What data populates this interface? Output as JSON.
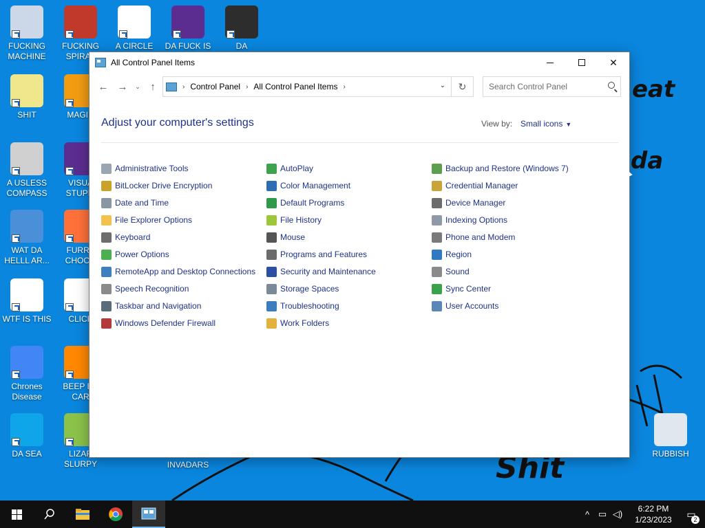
{
  "desktop": {
    "icons": [
      {
        "label": "FUCKING MACHINE",
        "color": "#ccd7e8"
      },
      {
        "label": "FUCKING SPIRAL",
        "color": "#c0392b"
      },
      {
        "label": "A CIRCLE",
        "color": "#ffffff"
      },
      {
        "label": "DA FUCK IS",
        "color": "#5c2d91"
      },
      {
        "label": "DA UNIVERSE",
        "color": "#2d2d2d"
      },
      {
        "label": "SHIT",
        "color": "#f0e68c"
      },
      {
        "label": "MAGIN",
        "color": "#f39c12"
      },
      {
        "label": "A USLESS COMPASS",
        "color": "#d0d0d0"
      },
      {
        "label": "VISUA STUPIT",
        "color": "#5c2d91"
      },
      {
        "label": "WAT DA HELLL AR...",
        "color": "#4a90d9"
      },
      {
        "label": "FURRY CHOCO",
        "color": "#ff7139"
      },
      {
        "label": "WTF IS THIS",
        "color": "#ffffff"
      },
      {
        "label": "CLICK",
        "color": "#ffffff"
      },
      {
        "label": "Chrones Disease",
        "color": "#4285f4"
      },
      {
        "label": "BEEP BE CAR",
        "color": "#ff8800"
      },
      {
        "label": "DA SEA",
        "color": "#0ea5e9"
      },
      {
        "label": "LIZAR SLURPY",
        "color": "#8bc34a"
      },
      {
        "label": "INVADARS",
        "color": "#0a86de"
      },
      {
        "label": "RUBBISH",
        "color": "#dfe7ef"
      }
    ],
    "wallpaper_words": [
      "eat",
      "da",
      "Shit"
    ]
  },
  "window": {
    "title": "All Control Panel Items",
    "nav": {
      "breadcrumbs": [
        "Control Panel",
        "All Control Panel Items"
      ],
      "search_placeholder": "Search Control Panel"
    },
    "heading": "Adjust your computer's settings",
    "view_by_label": "View by:",
    "view_by_value": "Small icons",
    "columns": [
      [
        {
          "label": "Administrative Tools",
          "icon": "admin-tools-icon",
          "color": "#9aa5b1"
        },
        {
          "label": "BitLocker Drive Encryption",
          "icon": "bitlocker-icon",
          "color": "#c9a227"
        },
        {
          "label": "Date and Time",
          "icon": "clock-icon",
          "color": "#8a96a3"
        },
        {
          "label": "File Explorer Options",
          "icon": "folder-options-icon",
          "color": "#f2c14e"
        },
        {
          "label": "Keyboard",
          "icon": "keyboard-icon",
          "color": "#6d6d6d"
        },
        {
          "label": "Power Options",
          "icon": "power-icon",
          "color": "#4caf50"
        },
        {
          "label": "RemoteApp and Desktop Connections",
          "icon": "remoteapp-icon",
          "color": "#3f7fbf"
        },
        {
          "label": "Speech Recognition",
          "icon": "microphone-icon",
          "color": "#8a8a8a"
        },
        {
          "label": "Taskbar and Navigation",
          "icon": "taskbar-icon",
          "color": "#5a6b7a"
        },
        {
          "label": "Windows Defender Firewall",
          "icon": "firewall-icon",
          "color": "#b33a3a"
        }
      ],
      [
        {
          "label": "AutoPlay",
          "icon": "autoplay-icon",
          "color": "#3fa34d"
        },
        {
          "label": "Color Management",
          "icon": "color-management-icon",
          "color": "#2e6db4"
        },
        {
          "label": "Default Programs",
          "icon": "default-programs-icon",
          "color": "#2e9a4a"
        },
        {
          "label": "File History",
          "icon": "file-history-icon",
          "color": "#9cc73b"
        },
        {
          "label": "Mouse",
          "icon": "mouse-icon",
          "color": "#555555"
        },
        {
          "label": "Programs and Features",
          "icon": "programs-icon",
          "color": "#6b6b6b"
        },
        {
          "label": "Security and Maintenance",
          "icon": "flag-icon",
          "color": "#2b4fa3"
        },
        {
          "label": "Storage Spaces",
          "icon": "storage-icon",
          "color": "#7b8a99"
        },
        {
          "label": "Troubleshooting",
          "icon": "troubleshooting-icon",
          "color": "#3c7dbf"
        },
        {
          "label": "Work Folders",
          "icon": "work-folders-icon",
          "color": "#e3b23c"
        }
      ],
      [
        {
          "label": "Backup and Restore (Windows 7)",
          "icon": "backup-icon",
          "color": "#5aa04f"
        },
        {
          "label": "Credential Manager",
          "icon": "credential-icon",
          "color": "#c8a43a"
        },
        {
          "label": "Device Manager",
          "icon": "device-manager-icon",
          "color": "#6c6c6c"
        },
        {
          "label": "Indexing Options",
          "icon": "indexing-icon",
          "color": "#8e9aa6"
        },
        {
          "label": "Phone and Modem",
          "icon": "phone-icon",
          "color": "#7a7a7a"
        },
        {
          "label": "Region",
          "icon": "globe-icon",
          "color": "#2f78c4"
        },
        {
          "label": "Sound",
          "icon": "speaker-icon",
          "color": "#8a8a8a"
        },
        {
          "label": "Sync Center",
          "icon": "sync-icon",
          "color": "#3aa24a"
        },
        {
          "label": "User Accounts",
          "icon": "user-accounts-icon",
          "color": "#5b87b8"
        }
      ]
    ]
  },
  "taskbar": {
    "time": "6:22 PM",
    "date": "1/23/2023",
    "notifications": "2"
  },
  "colors": {
    "desktop_bg": "#0a86de",
    "link_blue": "#1e3287",
    "taskbar_bg": "#101010"
  }
}
